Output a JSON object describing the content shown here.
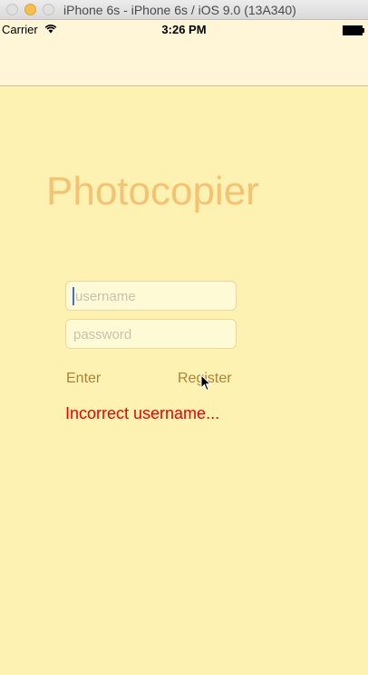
{
  "window": {
    "title": "iPhone 6s - iPhone 6s / iOS 9.0 (13A340)"
  },
  "status_bar": {
    "carrier": "Carrier",
    "time": "3:26 PM"
  },
  "app": {
    "title": "Photocopier",
    "username_placeholder": "username",
    "password_placeholder": "password",
    "enter_label": "Enter",
    "register_label": "Register",
    "error_message": "Incorrect username..."
  },
  "colors": {
    "background": "#fef2b3",
    "title": "#f4c272",
    "button": "#a9843a",
    "error": "#ee0000"
  }
}
